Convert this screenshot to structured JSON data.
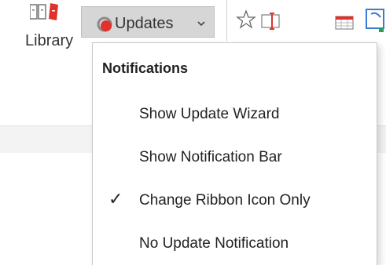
{
  "ribbon": {
    "library_label": "Library",
    "updates_label": "Updates",
    "icons": [
      "library-icon",
      "updates-status-icon",
      "chevron-down-icon",
      "star-icon",
      "textbox-icon",
      "calendar-icon"
    ]
  },
  "menu": {
    "header": "Notifications",
    "items": [
      {
        "label": "Show Update Wizard",
        "checked": false
      },
      {
        "label": "Show Notification Bar",
        "checked": false
      },
      {
        "label": "Change Ribbon Icon Only",
        "checked": true
      },
      {
        "label": "No Update Notification",
        "checked": false
      }
    ],
    "check_glyph": "✓"
  },
  "colors": {
    "accent_red": "#e0312a",
    "selected_button_bg": "#d6d6d6",
    "ribbon_lower_bg": "#f3f3f3"
  }
}
